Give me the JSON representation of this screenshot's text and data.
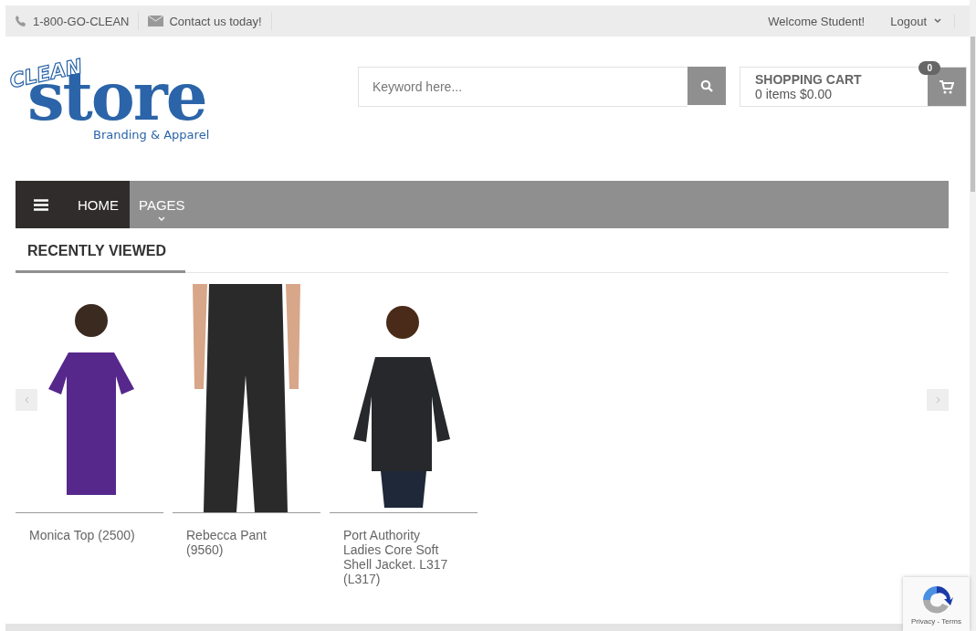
{
  "top_bar": {
    "phone": "1-800-GO-CLEAN",
    "contact": "Contact us today!",
    "welcome": "Welcome Student!",
    "logout": "Logout"
  },
  "logo": {
    "top": "CLEAN",
    "main": "store",
    "tagline": "Branding & Apparel"
  },
  "search": {
    "placeholder": "Keyword here..."
  },
  "cart": {
    "title": "SHOPPING CART",
    "summary": "0 items $0.00",
    "count": "0"
  },
  "nav": [
    {
      "label": "HOME",
      "selected": true,
      "dropdown": false
    },
    {
      "label": "PAGES",
      "selected": false,
      "dropdown": true
    }
  ],
  "recently_viewed": {
    "title": "RECENTLY VIEWED",
    "products": [
      {
        "name": "Monica Top (2500)",
        "kind": "top"
      },
      {
        "name": "Rebecca Pant (9560)",
        "kind": "pant"
      },
      {
        "name": "Port Authority Ladies Core Soft Shell Jacket. L317 (L317)",
        "kind": "jacket"
      }
    ]
  },
  "recaptcha": {
    "links": "Privacy - Terms"
  }
}
